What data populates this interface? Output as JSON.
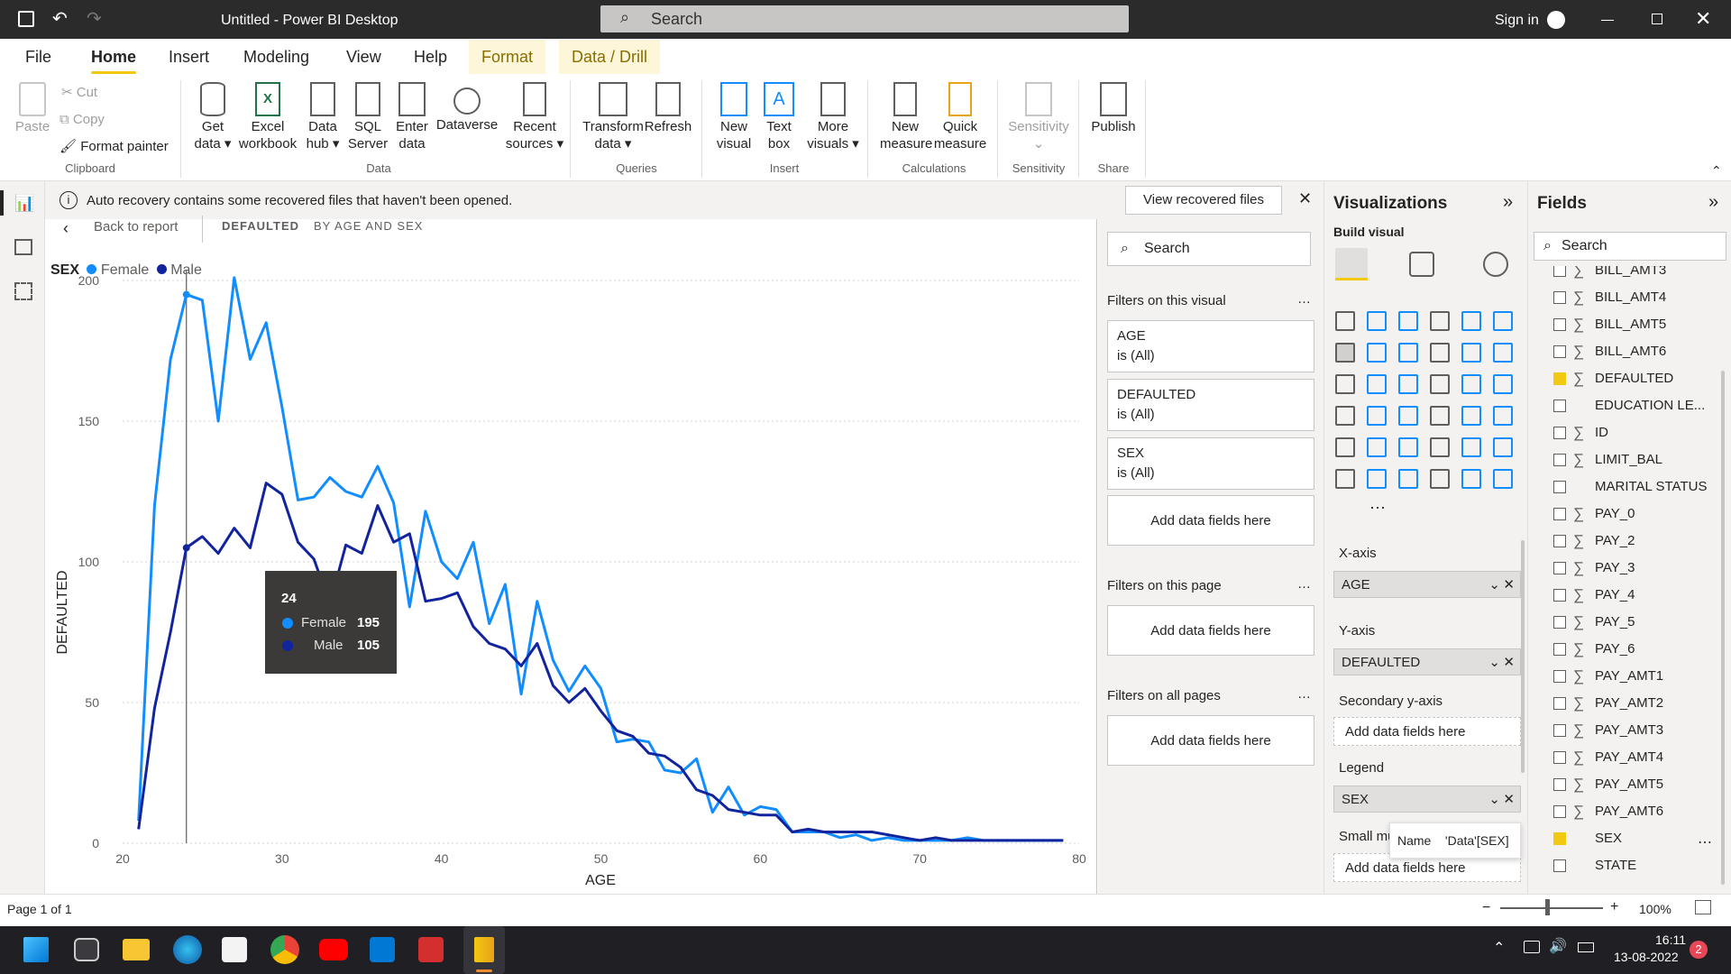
{
  "titlebar": {
    "title": "Untitled - Power BI Desktop",
    "search_placeholder": "Search",
    "signin": "Sign in"
  },
  "menu": [
    "File",
    "Home",
    "Insert",
    "Modeling",
    "View",
    "Help",
    "Format",
    "Data / Drill"
  ],
  "ribbon": {
    "clipboard": {
      "paste": "Paste",
      "cut": "Cut",
      "copy": "Copy",
      "format_painter": "Format painter",
      "group": "Clipboard"
    },
    "data": {
      "get_data": [
        "Get",
        "data"
      ],
      "excel": [
        "Excel",
        "workbook"
      ],
      "data_hub": [
        "Data",
        "hub"
      ],
      "sql": [
        "SQL",
        "Server"
      ],
      "enter": [
        "Enter",
        "data"
      ],
      "dataverse": "Dataverse",
      "recent": [
        "Recent",
        "sources"
      ],
      "group": "Data"
    },
    "queries": {
      "transform": [
        "Transform",
        "data"
      ],
      "refresh": "Refresh",
      "group": "Queries"
    },
    "insert": {
      "new_visual": [
        "New",
        "visual"
      ],
      "text_box": [
        "Text",
        "box"
      ],
      "more_visuals": [
        "More",
        "visuals"
      ],
      "group": "Insert"
    },
    "calculations": {
      "new_measure": [
        "New",
        "measure"
      ],
      "quick_measure": [
        "Quick",
        "measure"
      ],
      "group": "Calculations"
    },
    "sensitivity": {
      "label": "Sensitivity",
      "group": "Sensitivity"
    },
    "share": {
      "publish": "Publish",
      "group": "Share"
    }
  },
  "infobar": {
    "message": "Auto recovery contains some recovered files that haven't been opened.",
    "button": "View recovered files"
  },
  "report": {
    "back": "Back to report",
    "crumb1": "DEFAULTED",
    "crumb2": "BY AGE AND SEX"
  },
  "legend": {
    "title": "SEX",
    "female": "Female",
    "male": "Male"
  },
  "chart_data": {
    "type": "line",
    "xlabel": "AGE",
    "ylabel": "DEFAULTED",
    "xlim": [
      20,
      80
    ],
    "ylim": [
      0,
      200
    ],
    "xticks": [
      "20",
      "30",
      "40",
      "50",
      "60",
      "70",
      "80"
    ],
    "yticks": [
      "0",
      "50",
      "100",
      "150",
      "200"
    ],
    "colors": {
      "Female": "#118dff",
      "Male": "#12239e"
    },
    "series": [
      {
        "name": "Female",
        "x": [
          21,
          22,
          23,
          24,
          25,
          26,
          27,
          28,
          29,
          30,
          31,
          32,
          33,
          34,
          35,
          36,
          37,
          38,
          39,
          40,
          41,
          42,
          43,
          44,
          45,
          46,
          47,
          48,
          49,
          50,
          51,
          52,
          53,
          54,
          55,
          56,
          57,
          58,
          59,
          60,
          61,
          62,
          63,
          64,
          65,
          66,
          67,
          68,
          69,
          70,
          71,
          72,
          73,
          74,
          75,
          76,
          77,
          78,
          79
        ],
        "values": [
          8,
          120,
          172,
          195,
          193,
          150,
          201,
          172,
          185,
          155,
          122,
          123,
          130,
          125,
          123,
          134,
          121,
          84,
          118,
          100,
          94,
          107,
          78,
          92,
          53,
          86,
          65,
          54,
          63,
          55,
          36,
          37,
          36,
          26,
          25,
          30,
          11,
          20,
          10,
          13,
          12,
          4,
          4,
          4,
          2,
          3,
          1,
          2,
          1,
          1,
          1,
          1,
          2,
          1,
          1,
          1,
          1,
          1,
          1
        ]
      },
      {
        "name": "Male",
        "x": [
          21,
          22,
          23,
          24,
          25,
          26,
          27,
          28,
          29,
          30,
          31,
          32,
          33,
          34,
          35,
          36,
          37,
          38,
          39,
          40,
          41,
          42,
          43,
          44,
          45,
          46,
          47,
          48,
          49,
          50,
          51,
          52,
          53,
          54,
          55,
          56,
          57,
          58,
          59,
          60,
          61,
          62,
          63,
          64,
          65,
          66,
          67,
          68,
          69,
          70,
          71,
          72,
          73,
          74,
          75,
          76,
          77,
          78,
          79
        ],
        "values": [
          5,
          48,
          75,
          105,
          109,
          103,
          112,
          105,
          128,
          124,
          107,
          101,
          85,
          106,
          103,
          120,
          107,
          110,
          86,
          87,
          89,
          77,
          71,
          69,
          63,
          71,
          56,
          50,
          55,
          47,
          40,
          38,
          32,
          31,
          27,
          19,
          17,
          12,
          11,
          10,
          10,
          4,
          5,
          4,
          4,
          4,
          4,
          3,
          2,
          1,
          2,
          1,
          1,
          1,
          1,
          1,
          1,
          1,
          1
        ]
      }
    ],
    "tooltip": {
      "x": "24",
      "rows": [
        {
          "name": "Female",
          "value": "195"
        },
        {
          "name": "Male",
          "value": "105"
        }
      ]
    }
  },
  "filters": {
    "search": "Search",
    "on_visual": "Filters on this visual",
    "cards": [
      {
        "field": "AGE",
        "value": "is (All)"
      },
      {
        "field": "DEFAULTED",
        "value": "is (All)"
      },
      {
        "field": "SEX",
        "value": "is (All)"
      }
    ],
    "add": "Add data fields here",
    "on_page": "Filters on this page",
    "on_all": "Filters on all pages"
  },
  "viz": {
    "title": "Visualizations",
    "build": "Build visual",
    "xaxis": "X-axis",
    "xfield": "AGE",
    "yaxis": "Y-axis",
    "yfield": "DEFAULTED",
    "secondary": "Secondary y-axis",
    "legend": "Legend",
    "legendfield": "SEX",
    "small": "Small mu",
    "add": "Add data fields here",
    "tip_name": "Name",
    "tip_value": "'Data'[SEX]"
  },
  "fields": {
    "title": "Fields",
    "search": "Search",
    "items": [
      {
        "name": "BILL_AMT3",
        "sigma": true,
        "checked": false
      },
      {
        "name": "BILL_AMT4",
        "sigma": true,
        "checked": false
      },
      {
        "name": "BILL_AMT5",
        "sigma": true,
        "checked": false
      },
      {
        "name": "BILL_AMT6",
        "sigma": true,
        "checked": false
      },
      {
        "name": "DEFAULTED",
        "sigma": true,
        "checked": true
      },
      {
        "name": "EDUCATION LE...",
        "sigma": false,
        "checked": false
      },
      {
        "name": "ID",
        "sigma": true,
        "checked": false
      },
      {
        "name": "LIMIT_BAL",
        "sigma": true,
        "checked": false
      },
      {
        "name": "MARITAL STATUS",
        "sigma": false,
        "checked": false
      },
      {
        "name": "PAY_0",
        "sigma": true,
        "checked": false
      },
      {
        "name": "PAY_2",
        "sigma": true,
        "checked": false
      },
      {
        "name": "PAY_3",
        "sigma": true,
        "checked": false
      },
      {
        "name": "PAY_4",
        "sigma": true,
        "checked": false
      },
      {
        "name": "PAY_5",
        "sigma": true,
        "checked": false
      },
      {
        "name": "PAY_6",
        "sigma": true,
        "checked": false
      },
      {
        "name": "PAY_AMT1",
        "sigma": true,
        "checked": false
      },
      {
        "name": "PAY_AMT2",
        "sigma": true,
        "checked": false
      },
      {
        "name": "PAY_AMT3",
        "sigma": true,
        "checked": false
      },
      {
        "name": "PAY_AMT4",
        "sigma": true,
        "checked": false
      },
      {
        "name": "PAY_AMT5",
        "sigma": true,
        "checked": false
      },
      {
        "name": "PAY_AMT6",
        "sigma": true,
        "checked": false
      },
      {
        "name": "SEX",
        "sigma": false,
        "checked": true
      },
      {
        "name": "STATE",
        "sigma": false,
        "checked": false
      }
    ]
  },
  "status": {
    "page": "Page 1 of 1",
    "zoom": "100%"
  },
  "taskbar": {
    "time": "16:11",
    "date": "13-08-2022",
    "badge": "2"
  }
}
